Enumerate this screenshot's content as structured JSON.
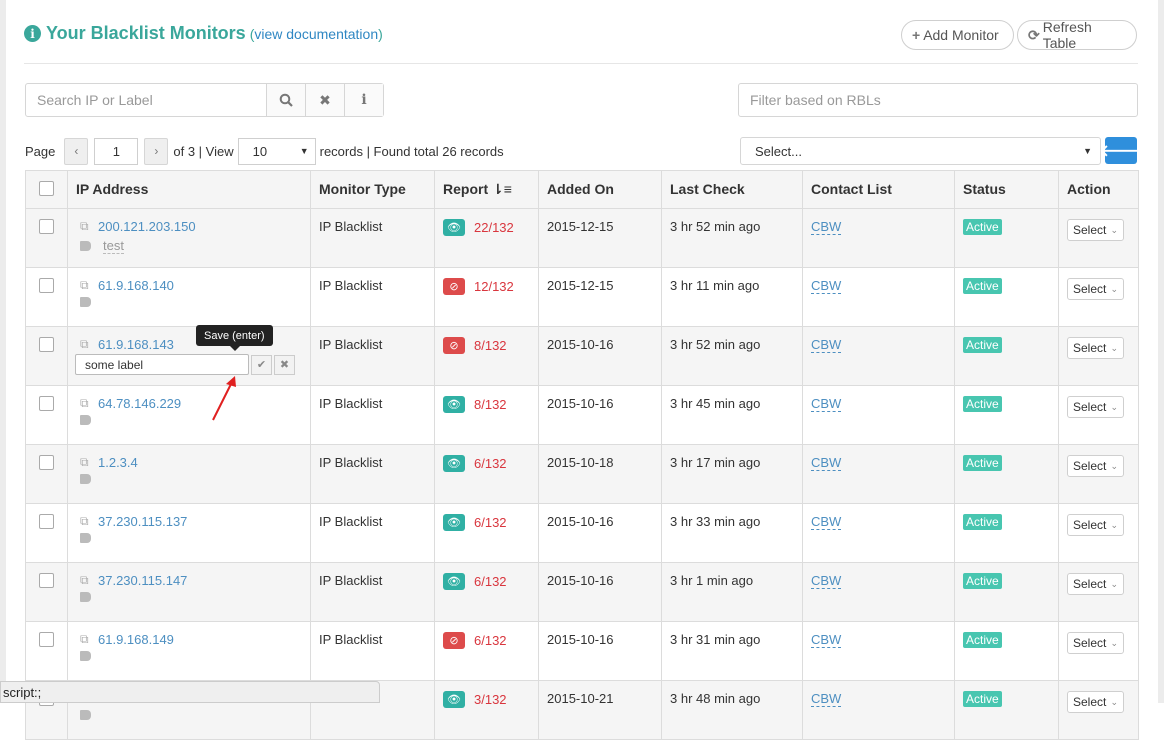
{
  "header": {
    "title": "Your Blacklist Monitors",
    "paren_open": "(",
    "doc_link": "view documentation",
    "paren_close": ")",
    "add_button": "Add Monitor",
    "refresh_button": "Refresh Table"
  },
  "search": {
    "placeholder": "Search IP or Label",
    "rbl_placeholder": "Filter based on RBLs"
  },
  "paging": {
    "page_label": "Page",
    "page_value": "1",
    "of_text": "of 3 | View",
    "view_value": "10",
    "records_text": "records | Found total 26 records",
    "rbl_select": "Select..."
  },
  "columns": {
    "ip": "IP Address",
    "type": "Monitor Type",
    "report": "Report",
    "added": "Added On",
    "last": "Last Check",
    "contact": "Contact List",
    "status": "Status",
    "action": "Action"
  },
  "rows": [
    {
      "ip": "200.121.203.150",
      "label": "test",
      "type": "IP Blacklist",
      "report": "22/132",
      "report_ok": true,
      "added": "2015-12-15",
      "last": "3 hr 52 min ago",
      "contact": "CBW",
      "status": "Active",
      "action": "Select"
    },
    {
      "ip": "61.9.168.140",
      "label": "",
      "type": "IP Blacklist",
      "report": "12/132",
      "report_ok": false,
      "added": "2015-12-15",
      "last": "3 hr 11 min ago",
      "contact": "CBW",
      "status": "Active",
      "action": "Select"
    },
    {
      "ip": "61.9.168.143",
      "label": "some label",
      "type": "IP Blacklist",
      "report": "8/132",
      "report_ok": false,
      "added": "2015-10-16",
      "last": "3 hr 52 min ago",
      "contact": "CBW",
      "status": "Active",
      "action": "Select"
    },
    {
      "ip": "64.78.146.229",
      "label": "",
      "type": "IP Blacklist",
      "report": "8/132",
      "report_ok": true,
      "added": "2015-10-16",
      "last": "3 hr 45 min ago",
      "contact": "CBW",
      "status": "Active",
      "action": "Select"
    },
    {
      "ip": "1.2.3.4",
      "label": "",
      "type": "IP Blacklist",
      "report": "6/132",
      "report_ok": true,
      "added": "2015-10-18",
      "last": "3 hr 17 min ago",
      "contact": "CBW",
      "status": "Active",
      "action": "Select"
    },
    {
      "ip": "37.230.115.137",
      "label": "",
      "type": "IP Blacklist",
      "report": "6/132",
      "report_ok": true,
      "added": "2015-10-16",
      "last": "3 hr 33 min ago",
      "contact": "CBW",
      "status": "Active",
      "action": "Select"
    },
    {
      "ip": "37.230.115.147",
      "label": "",
      "type": "IP Blacklist",
      "report": "6/132",
      "report_ok": true,
      "added": "2015-10-16",
      "last": "3 hr 1 min ago",
      "contact": "CBW",
      "status": "Active",
      "action": "Select"
    },
    {
      "ip": "61.9.168.149",
      "label": "",
      "type": "IP Blacklist",
      "report": "6/132",
      "report_ok": false,
      "added": "2015-10-16",
      "last": "3 hr 31 min ago",
      "contact": "CBW",
      "status": "Active",
      "action": "Select"
    },
    {
      "ip": "",
      "label": "",
      "type": "",
      "report": "3/132",
      "report_ok": true,
      "added": "2015-10-21",
      "last": "3 hr 48 min ago",
      "contact": "CBW",
      "status": "Active",
      "action": "Select"
    }
  ],
  "editor": {
    "tooltip": "Save (enter)"
  },
  "status_bar": "script:;",
  "colors": {
    "accent": "#3aa79b",
    "link": "#4d8fc1",
    "danger": "#dd4b4b",
    "badge": "#48c6b0",
    "primary_button": "#2f8fdc"
  }
}
